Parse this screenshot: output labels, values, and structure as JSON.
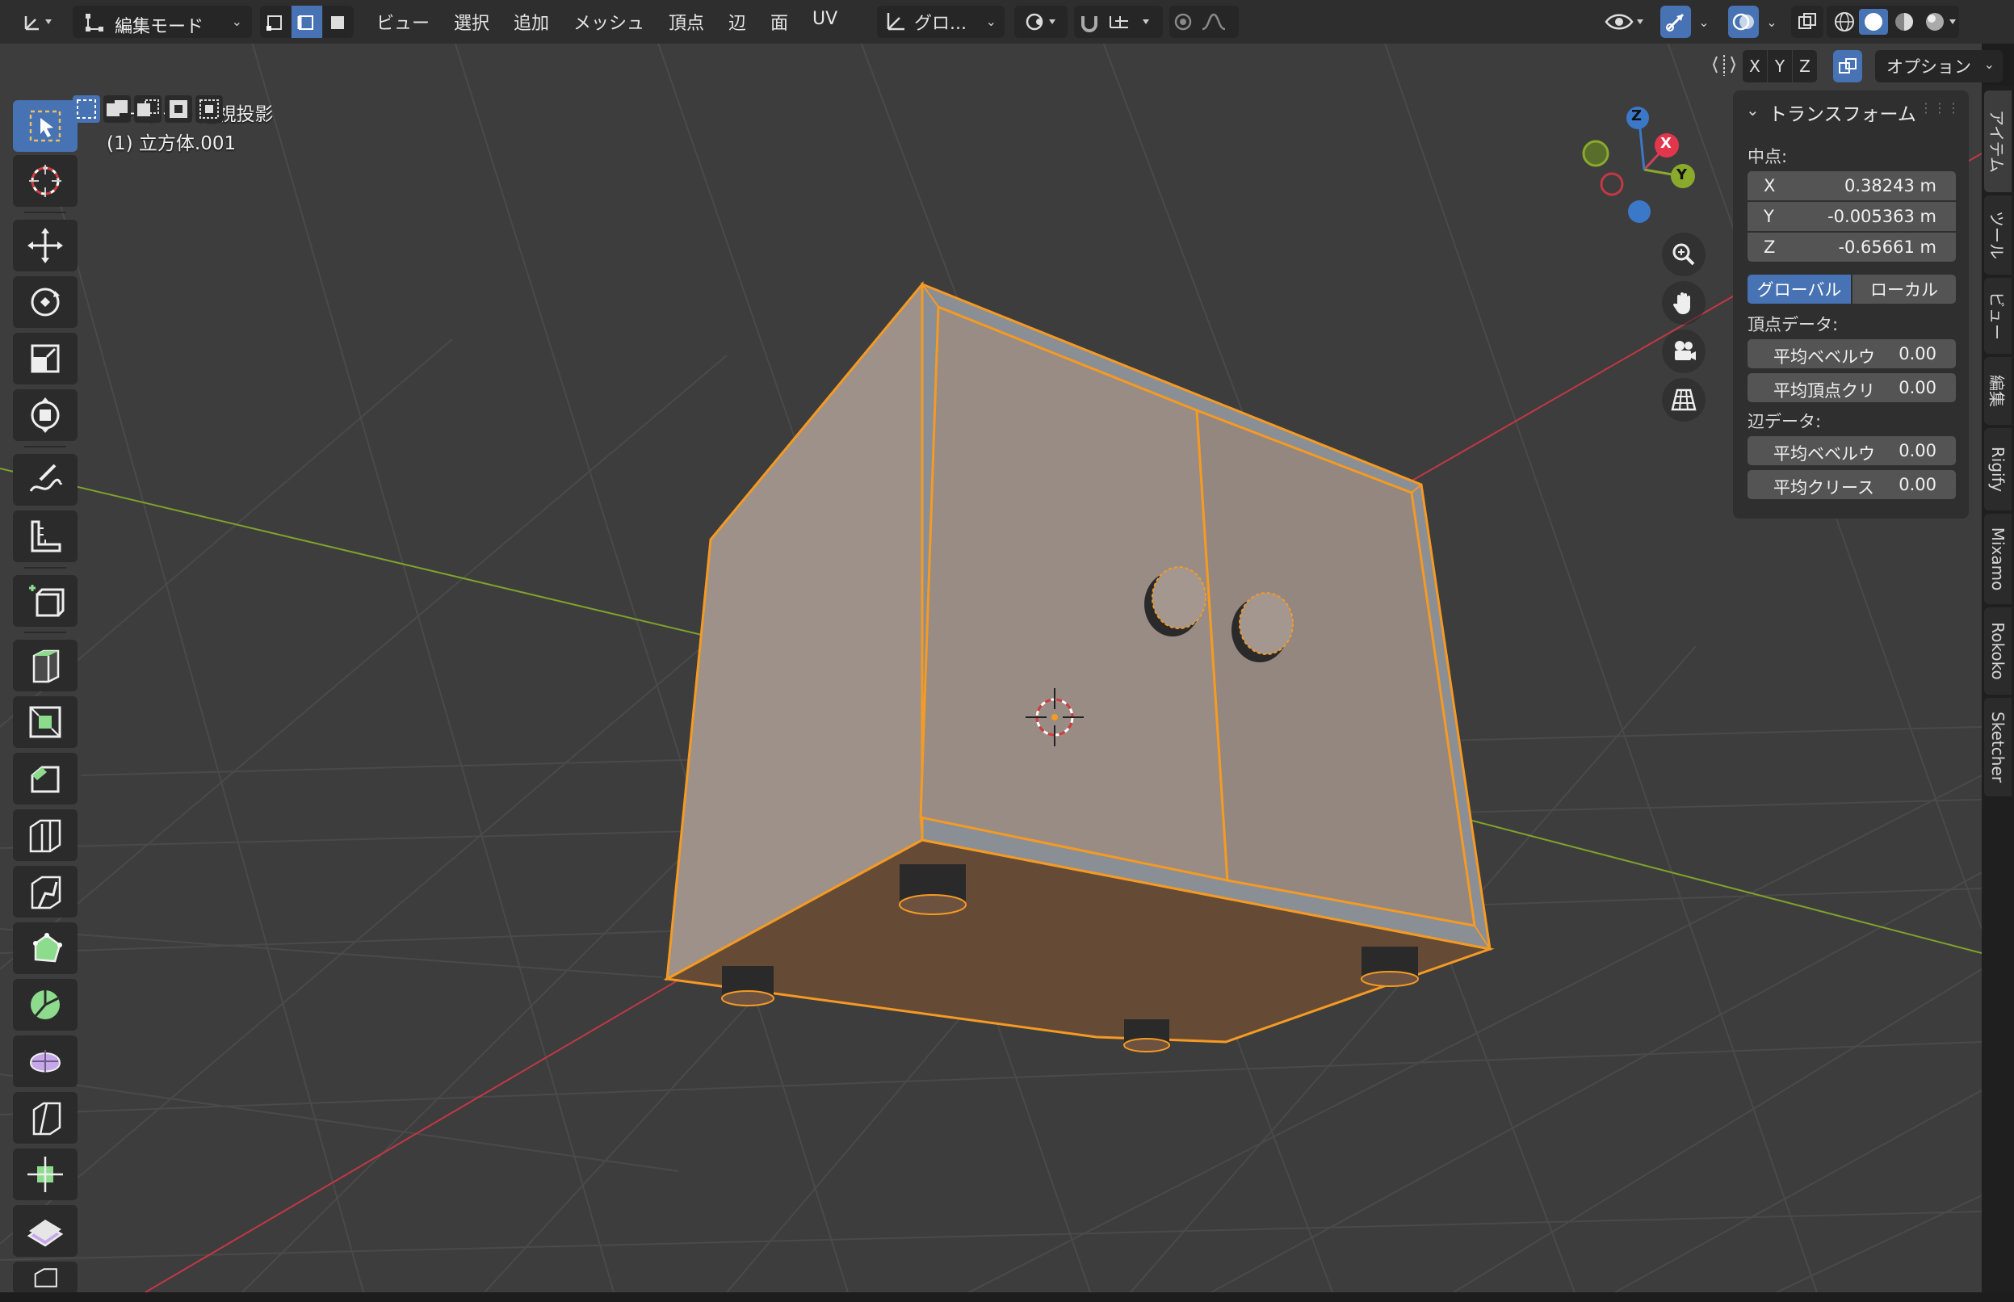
{
  "header": {
    "mode": "編集モード",
    "menus": [
      "ビュー",
      "選択",
      "追加",
      "メッシュ",
      "頂点",
      "辺",
      "面",
      "UV"
    ],
    "transform_orientation": "グロ...",
    "axes": [
      "X",
      "Y",
      "Z"
    ],
    "options_label": "オプション"
  },
  "viewport": {
    "view_name": "ユーザー・透視投影",
    "object_name": "(1) 立方体.001",
    "colors": {
      "background": "#3d3d3d",
      "selection": "#f59a23",
      "x_axis": "#c23845",
      "y_axis": "#7ea22c"
    }
  },
  "gizmo": {
    "x": "X",
    "y": "Y",
    "z": "Z"
  },
  "npanel": {
    "title": "トランスフォーム",
    "median_label": "中点:",
    "x_label": "X",
    "x_value": "0.38243 m",
    "y_label": "Y",
    "y_value": "-0.005363 m",
    "z_label": "Z",
    "z_value": "-0.65661 m",
    "global_label": "グローバル",
    "local_label": "ローカル",
    "vertex_data_label": "頂点データ:",
    "vert_bevel_label": "平均ベベルウ",
    "vert_bevel_value": "0.00",
    "vert_crease_label": "平均頂点クリ",
    "vert_crease_value": "0.00",
    "edge_data_label": "辺データ:",
    "edge_bevel_label": "平均ベベルウ",
    "edge_bevel_value": "0.00",
    "edge_crease_label": "平均クリース",
    "edge_crease_value": "0.00"
  },
  "side_tabs": [
    "アイテム",
    "ツール",
    "ビュー",
    "編集",
    "Rigify",
    "Mixamo",
    "Rokoko",
    "Sketcher"
  ]
}
